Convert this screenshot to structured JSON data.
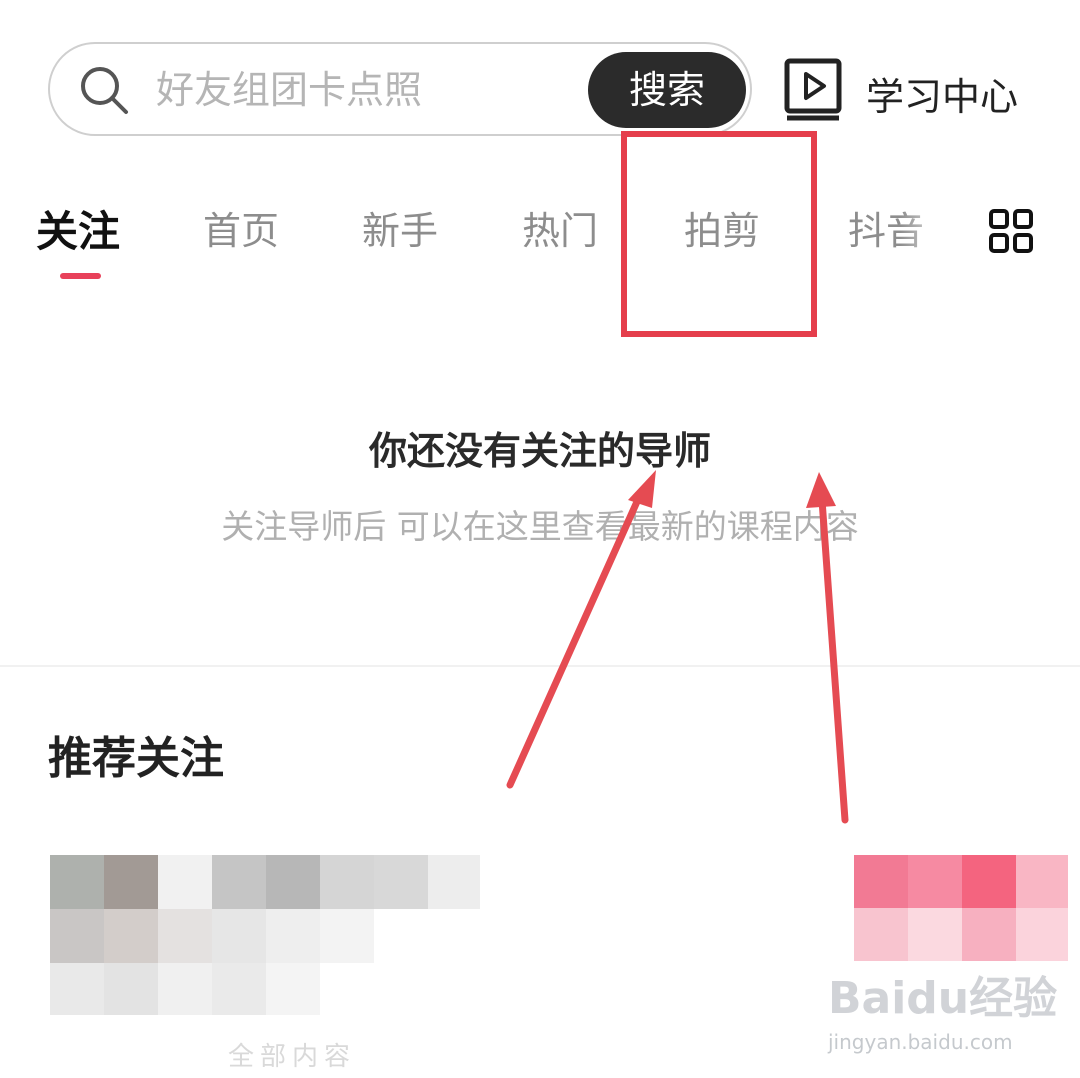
{
  "search": {
    "placeholder": "好友组团卡点照",
    "button_label": "搜索"
  },
  "header": {
    "learning_center_label": "学习中心"
  },
  "tabs": [
    {
      "label": "关注",
      "active": true
    },
    {
      "label": "首页",
      "active": false
    },
    {
      "label": "新手",
      "active": false
    },
    {
      "label": "热门",
      "active": false
    },
    {
      "label": "拍剪",
      "active": false
    },
    {
      "label": "抖音",
      "active": false
    }
  ],
  "empty_state": {
    "title": "你还没有关注的导师",
    "subtitle": "关注导师后 可以在这里查看最新的课程内容"
  },
  "recommend": {
    "title": "推荐关注",
    "blurred_text": "全部内容"
  },
  "watermark": {
    "brand": "Baidu经验",
    "url": "jingyan.baidu.com"
  },
  "colors": {
    "accent": "#e8415a",
    "highlight": "#e53e4c",
    "button_bg": "#2b2b2b"
  },
  "icons": {
    "search": "search-icon",
    "learning": "play-book-icon",
    "grid": "grid-icon"
  }
}
